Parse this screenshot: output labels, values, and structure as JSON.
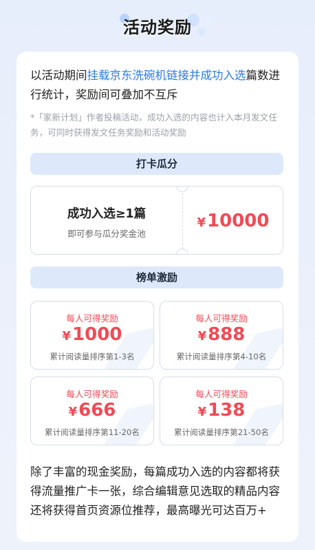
{
  "header": {
    "title": "活动奖励"
  },
  "intro": {
    "prefix": "以活动期间",
    "highlight": "挂载京东洗碗机链接并成功入选",
    "suffix": "篇数进行统计，奖励间可叠加不互斥"
  },
  "note": "*「家新计划」作者投稿活动，成功入选的内容也计入本月发文任务，可同时获得发文任务奖励和活动奖励",
  "checkin": {
    "section_title": "打卡瓜分",
    "condition": "成功入选≥1篇",
    "condition_sub": "即可参与瓜分奖金池",
    "currency": "¥",
    "pool_amount": "10000"
  },
  "ranking": {
    "section_title": "榜单激励",
    "items": [
      {
        "caption": "每人可得奖励",
        "currency": "¥",
        "amount": "1000",
        "rank": "累计阅读量排序第1-3名"
      },
      {
        "caption": "每人可得奖励",
        "currency": "¥",
        "amount": "888",
        "rank": "累计阅读量排序第4-10名"
      },
      {
        "caption": "每人可得奖励",
        "currency": "¥",
        "amount": "666",
        "rank": "累计阅读量排序第11-20名"
      },
      {
        "caption": "每人可得奖励",
        "currency": "¥",
        "amount": "138",
        "rank": "累计阅读量排序第21-50名"
      }
    ]
  },
  "outro": "除了丰富的现金奖励，每篇成功入选的内容都将获得流量推广卡一张，综合编辑意见选取的精品内容还将获得首页资源位推荐，最高曝光可达百万+",
  "colors": {
    "accent": "#f04a55",
    "highlight": "#2b7be8",
    "section_bg": "#dde9fb"
  }
}
